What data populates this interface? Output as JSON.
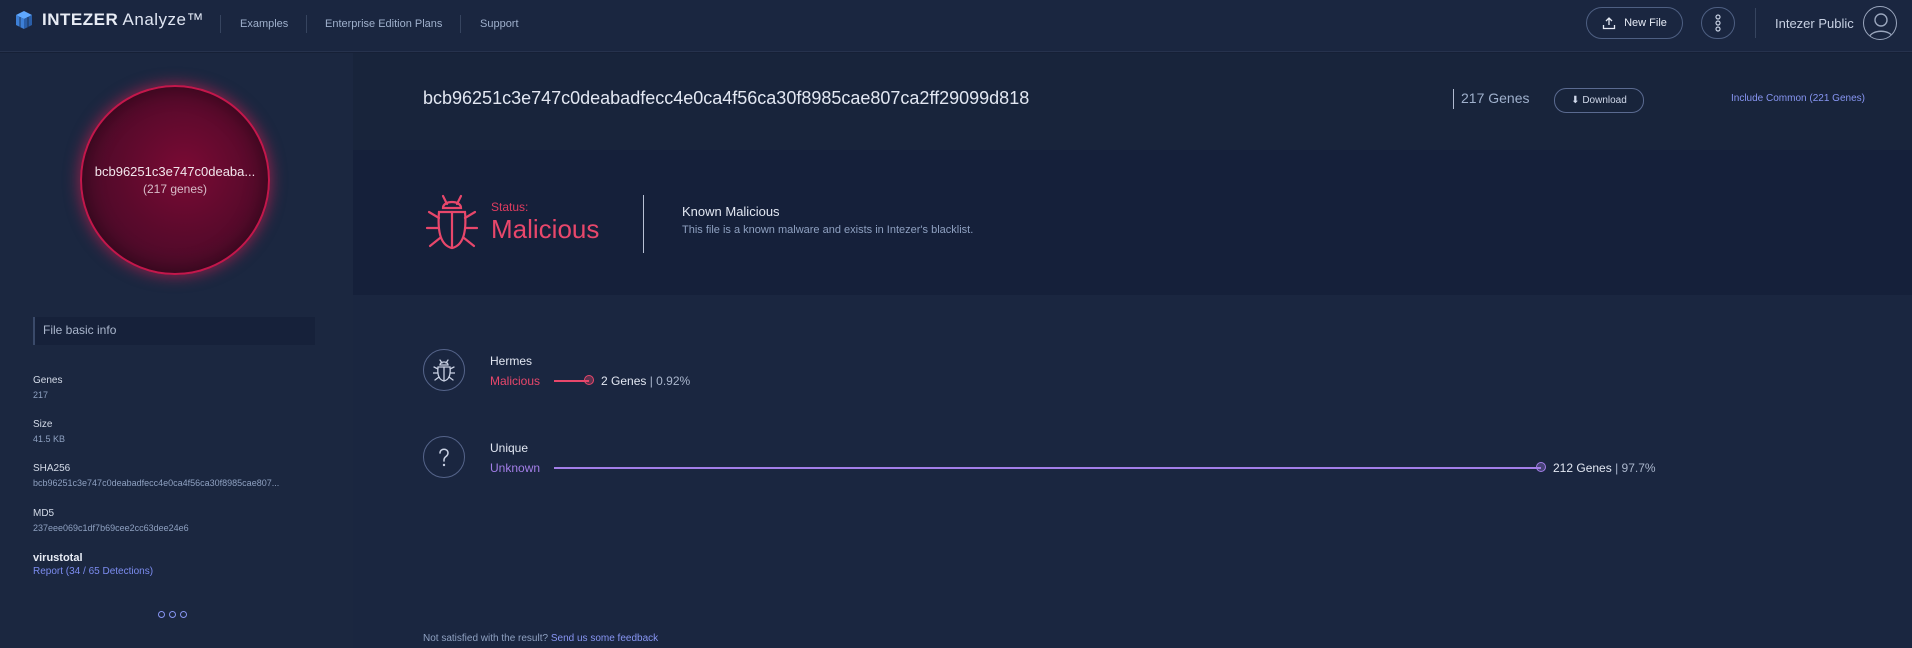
{
  "app": {
    "logo_bold": "INTEZER",
    "logo_rest": " Analyze™",
    "nav": [
      "Examples",
      "Enterprise Edition Plans",
      "Support"
    ],
    "new_file_label": "New File",
    "user_name": "Intezer Public"
  },
  "sidebar": {
    "genome_name": "bcb96251c3e747c0deaba...",
    "genome_genes": "(217 genes)",
    "tab_label": "File basic info",
    "info": [
      {
        "label": "Genes",
        "value": "217"
      },
      {
        "label": "Size",
        "value": "41.5 KB"
      },
      {
        "label": "SHA256",
        "value": "bcb96251c3e747c0deabadfecc4e0ca4f56ca30f8985cae807..."
      },
      {
        "label": "MD5",
        "value": "237eee069c1df7b69cee2cc63dee24e6"
      }
    ],
    "virustotal_label": "virustotal",
    "virustotal_report": "Report (34 / 65 Detections)"
  },
  "main": {
    "hash": "bcb96251c3e747c0deabadfecc4e0ca4f56ca30f8985cae807ca2ff29099d818",
    "gene_count": "217 Genes",
    "download_label": "⬇ Download",
    "include_common": "Include Common (221 Genes)",
    "status_label": "Status:",
    "status_value": "Malicious",
    "status_title": "Known Malicious",
    "status_desc": "This file is a known malware and exists in Intezer's blacklist.",
    "families": [
      {
        "name": "Hermes",
        "type": "Malicious",
        "genes": "2 Genes",
        "percent": "0.92%",
        "share": 0.0092,
        "color": "#e8476b"
      },
      {
        "name": "Unique",
        "type": "Unknown",
        "genes": "212 Genes",
        "percent": "97.7%",
        "share": 0.977,
        "color": "#a37ee8"
      }
    ],
    "feedback_text": "Not satisfied with the result?",
    "feedback_link": "Send us some feedback"
  },
  "colors": {
    "malicious": "#e8476b",
    "unknown": "#a37ee8",
    "accent": "#8795f2"
  }
}
